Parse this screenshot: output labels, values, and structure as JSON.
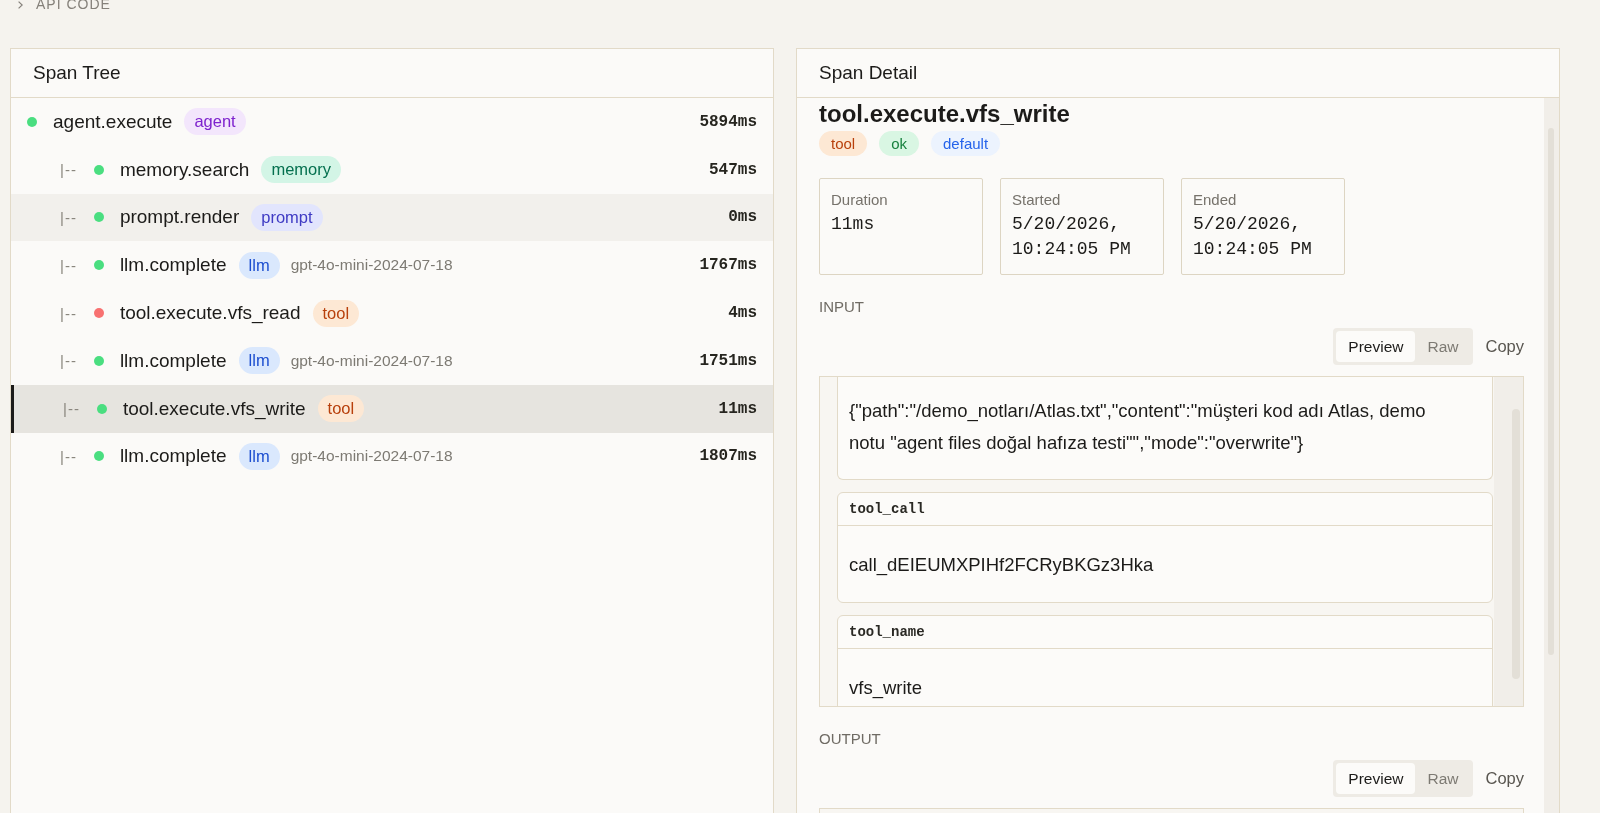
{
  "api_code": {
    "label": "API CODE",
    "expanded": false
  },
  "span_tree": {
    "title": "Span Tree",
    "spans": [
      {
        "name": "agent.execute",
        "color": "#4ade80",
        "badge": {
          "label": "agent",
          "kind": "agent"
        },
        "duration": "5894ms",
        "selected": false,
        "hovered": false,
        "children": [
          {
            "prefix": "|--",
            "name": "memory.search",
            "color": "#4ade80",
            "badge": {
              "label": "memory",
              "kind": "memory"
            },
            "duration": "547ms",
            "selected": false,
            "hovered": false
          },
          {
            "prefix": "|--",
            "name": "prompt.render",
            "color": "#4ade80",
            "badge": {
              "label": "prompt",
              "kind": "prompt"
            },
            "duration": "0ms",
            "selected": false,
            "hovered": true
          },
          {
            "prefix": "|--",
            "name": "llm.complete",
            "color": "#4ade80",
            "badge": {
              "label": "llm",
              "kind": "llm"
            },
            "model": "gpt-4o-mini-2024-07-18",
            "duration": "1767ms",
            "selected": false,
            "hovered": false
          },
          {
            "prefix": "|--",
            "name": "tool.execute.vfs_read",
            "color": "#f87171",
            "badge": {
              "label": "tool",
              "kind": "tool"
            },
            "duration": "4ms",
            "selected": false,
            "hovered": false
          },
          {
            "prefix": "|--",
            "name": "llm.complete",
            "color": "#4ade80",
            "badge": {
              "label": "llm",
              "kind": "llm"
            },
            "model": "gpt-4o-mini-2024-07-18",
            "duration": "1751ms",
            "selected": false,
            "hovered": false
          },
          {
            "prefix": "|--",
            "name": "tool.execute.vfs_write",
            "color": "#4ade80",
            "badge": {
              "label": "tool",
              "kind": "tool"
            },
            "duration": "11ms",
            "selected": true,
            "hovered": false
          },
          {
            "prefix": "|--",
            "name": "llm.complete",
            "color": "#4ade80",
            "badge": {
              "label": "llm",
              "kind": "llm"
            },
            "model": "gpt-4o-mini-2024-07-18",
            "duration": "1807ms",
            "selected": false,
            "hovered": false
          }
        ]
      }
    ]
  },
  "span_detail": {
    "title": "Span Detail",
    "span_name": "tool.execute.vfs_write",
    "badges": [
      {
        "label": "tool",
        "kind": "tool"
      },
      {
        "label": "ok",
        "kind": "ok"
      },
      {
        "label": "default",
        "kind": "default"
      }
    ],
    "stats": [
      {
        "label": "Duration",
        "value": "11ms"
      },
      {
        "label": "Started",
        "value": "5/20/2026, 10:24:05 PM"
      },
      {
        "label": "Ended",
        "value": "5/20/2026, 10:24:05 PM"
      }
    ],
    "sections": [
      {
        "label": "INPUT",
        "view_modes": [
          {
            "label": "Preview",
            "selected": true
          },
          {
            "label": "Raw",
            "selected": false
          }
        ],
        "copy": "Copy",
        "fields": [
          {
            "value": "{\"path\":\"/demo_notları/Atlas.txt\",\"content\":\"müşteri kod adı Atlas, demo notu \"agent files doğal hafıza testi\"\",\"mode\":\"overwrite\"}"
          },
          {
            "key": "tool_call",
            "value": "call_dEIEUMXPIHf2FCRyBKGz3Hka"
          },
          {
            "key": "tool_name",
            "value": "vfs_write"
          }
        ]
      },
      {
        "label": "OUTPUT",
        "view_modes": [
          {
            "label": "Preview",
            "selected": true
          },
          {
            "label": "Raw",
            "selected": false
          }
        ],
        "copy": "Copy"
      }
    ]
  }
}
